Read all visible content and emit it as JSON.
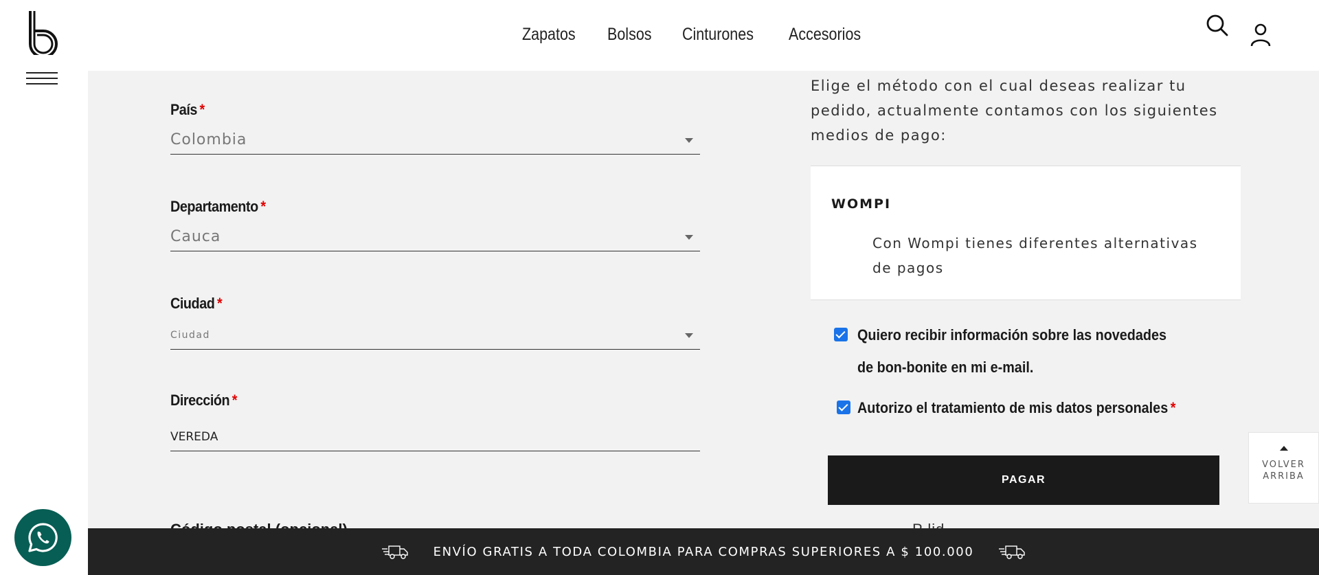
{
  "header": {
    "nav": [
      "Zapatos",
      "Bolsos",
      "Cinturones",
      "Accesorios"
    ]
  },
  "form": {
    "pais": {
      "label": "País",
      "value": "Colombia"
    },
    "departamento": {
      "label": "Departamento",
      "value": "Cauca"
    },
    "ciudad": {
      "label": "Ciudad",
      "placeholder": "Ciudad"
    },
    "direccion": {
      "label": "Dirección",
      "value": "VEREDA"
    },
    "codigo_postal": {
      "label": "Código postal (opcional)"
    },
    "required_mark": "*"
  },
  "payment": {
    "intro": "Elige el método con el cual deseas realizar tu pedido, actualmente contamos con los siguientes medios de pago:",
    "method_title": "WOMPI",
    "method_desc": "Con Wompi tienes diferentes alternativas de pagos",
    "newsletter_label": "Quiero recibir información sobre las novedades de bon-bonite en mi e-mail.",
    "newsletter_checked": true,
    "consent_label": "Autorizo el tratamiento de mis datos personales",
    "consent_checked": true,
    "pay_button": "PAGAR",
    "partial_text": "P                              lid"
  },
  "back_to_top": {
    "line1": "VOLVER",
    "line2": "ARRIBA"
  },
  "bottom_bar": {
    "text": "ENVÍO GRATIS A TODA COLOMBIA PARA COMPRAS SUPERIORES A $ 100.000"
  },
  "colors": {
    "accent": "#1a73e8",
    "required": "#e00000",
    "whatsapp": "#075e54",
    "bar": "#232323"
  }
}
